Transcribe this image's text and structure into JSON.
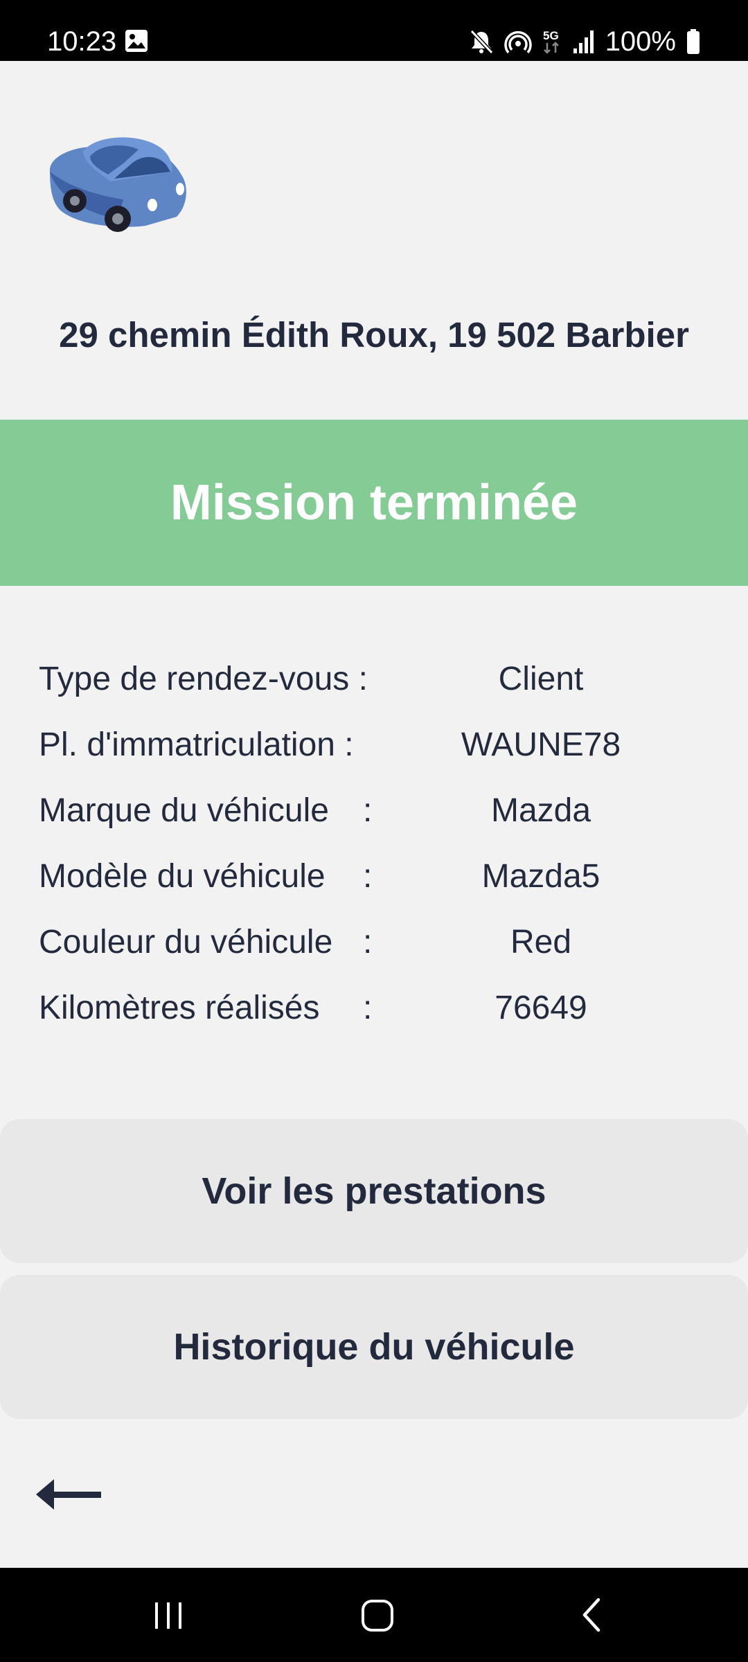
{
  "status_bar": {
    "time": "10:23",
    "battery": "100%",
    "icons": [
      "gallery-icon",
      "mute-icon",
      "hotspot-icon",
      "5g-icon",
      "signal-icon",
      "battery-icon"
    ]
  },
  "header": {
    "logo": "car-illustration",
    "address": "29 chemin Édith Roux, 19 502 Barbier"
  },
  "status_banner": {
    "text": "Mission terminée",
    "color": "#84cb96"
  },
  "details": [
    {
      "label": "Type de rendez-vous :",
      "colon": "",
      "value": "Client"
    },
    {
      "label": "Pl. d'immatriculation :",
      "colon": "",
      "value": "WAUNE78"
    },
    {
      "label": "Marque du véhicule",
      "colon": ":",
      "value": "Mazda"
    },
    {
      "label": "Modèle du véhicule",
      "colon": ":",
      "value": "Mazda5"
    },
    {
      "label": "Couleur du véhicule",
      "colon": ":",
      "value": "Red"
    },
    {
      "label": "Kilomètres réalisés",
      "colon": ":",
      "value": "76649"
    }
  ],
  "actions": {
    "prestations": "Voir les prestations",
    "historique": "Historique du véhicule"
  },
  "navigation": {
    "back_icon": "arrow-left-icon",
    "system_buttons": [
      "recents-icon",
      "home-icon",
      "back-icon"
    ]
  },
  "colors": {
    "text_dark": "#232a3d",
    "background": "#f2f2f2",
    "button_bg": "#e8e8e8"
  }
}
